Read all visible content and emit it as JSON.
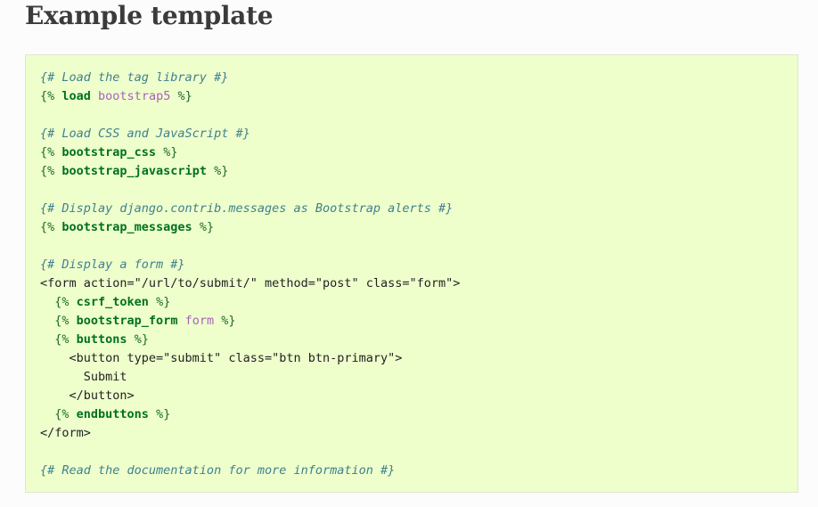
{
  "page": {
    "heading": "Example template"
  },
  "code": {
    "lines": [
      [
        {
          "t": "comment",
          "v": "{# Load the tag library #}"
        }
      ],
      [
        {
          "t": "delim",
          "v": "{% "
        },
        {
          "t": "kw",
          "v": "load"
        },
        {
          "t": "text",
          "v": " "
        },
        {
          "t": "arg",
          "v": "bootstrap5"
        },
        {
          "t": "delim",
          "v": " %}"
        }
      ],
      [],
      [
        {
          "t": "comment",
          "v": "{# Load CSS and JavaScript #}"
        }
      ],
      [
        {
          "t": "delim",
          "v": "{% "
        },
        {
          "t": "kw",
          "v": "bootstrap_css"
        },
        {
          "t": "delim",
          "v": " %}"
        }
      ],
      [
        {
          "t": "delim",
          "v": "{% "
        },
        {
          "t": "kw",
          "v": "bootstrap_javascript"
        },
        {
          "t": "delim",
          "v": " %}"
        }
      ],
      [],
      [
        {
          "t": "comment",
          "v": "{# Display django.contrib.messages as Bootstrap alerts #}"
        }
      ],
      [
        {
          "t": "delim",
          "v": "{% "
        },
        {
          "t": "kw",
          "v": "bootstrap_messages"
        },
        {
          "t": "delim",
          "v": " %}"
        }
      ],
      [],
      [
        {
          "t": "comment",
          "v": "{# Display a form #}"
        }
      ],
      [
        {
          "t": "html",
          "v": "<form action=\"/url/to/submit/\" method=\"post\" class=\"form\">"
        }
      ],
      [
        {
          "t": "text",
          "v": "  "
        },
        {
          "t": "delim",
          "v": "{% "
        },
        {
          "t": "kw",
          "v": "csrf_token"
        },
        {
          "t": "delim",
          "v": " %}"
        }
      ],
      [
        {
          "t": "text",
          "v": "  "
        },
        {
          "t": "delim",
          "v": "{% "
        },
        {
          "t": "kw",
          "v": "bootstrap_form"
        },
        {
          "t": "text",
          "v": " "
        },
        {
          "t": "arg",
          "v": "form"
        },
        {
          "t": "delim",
          "v": " %}"
        }
      ],
      [
        {
          "t": "text",
          "v": "  "
        },
        {
          "t": "delim",
          "v": "{% "
        },
        {
          "t": "kw",
          "v": "buttons"
        },
        {
          "t": "delim",
          "v": " %}"
        }
      ],
      [
        {
          "t": "html",
          "v": "    <button type=\"submit\" class=\"btn btn-primary\">"
        }
      ],
      [
        {
          "t": "text",
          "v": "      Submit"
        }
      ],
      [
        {
          "t": "html",
          "v": "    </button>"
        }
      ],
      [
        {
          "t": "text",
          "v": "  "
        },
        {
          "t": "delim",
          "v": "{% "
        },
        {
          "t": "kw",
          "v": "endbuttons"
        },
        {
          "t": "delim",
          "v": " %}"
        }
      ],
      [
        {
          "t": "html",
          "v": "</form>"
        }
      ],
      [],
      [
        {
          "t": "comment",
          "v": "{# Read the documentation for more information #}"
        }
      ]
    ]
  },
  "colors": {
    "code_background": "#eeffcc",
    "comment": "#40808f",
    "keyword": "#007020",
    "argument": "#a663b9"
  }
}
